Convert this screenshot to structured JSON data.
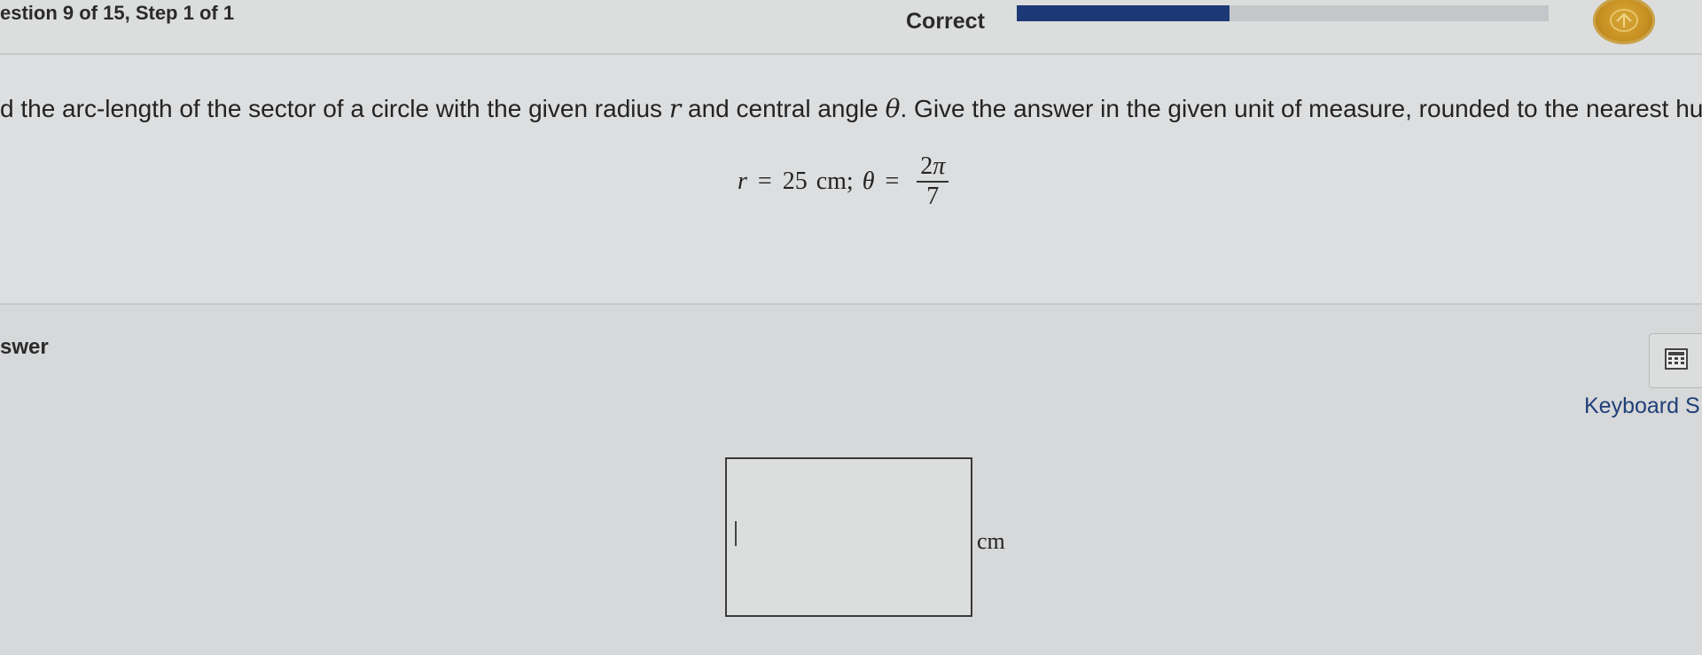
{
  "header": {
    "question_step": "estion 9 of 15, Step 1 of 1",
    "status": "Correct",
    "progress_fraction": 0.4,
    "accent_color": "#1c3975",
    "coin_icon": "coin-icon"
  },
  "problem": {
    "instruction_part1": "d the arc-length of the sector of a circle with the given radius ",
    "instruction_var_r": "r",
    "instruction_part2": " and central angle ",
    "instruction_var_theta": "θ",
    "instruction_part3": ". Give the answer in the given unit of measure, rounded to the nearest hunc",
    "given": {
      "r_var": "r",
      "equals": "=",
      "r_value": "25",
      "r_unit": "cm;",
      "theta_var": "θ",
      "frac_num": "2",
      "frac_pi": "π",
      "frac_den": "7"
    }
  },
  "answer": {
    "label": "swer",
    "calculator_icon": "calculator-icon",
    "keyboard_link": "Keyboard S",
    "input_value": "",
    "unit": "cm"
  }
}
